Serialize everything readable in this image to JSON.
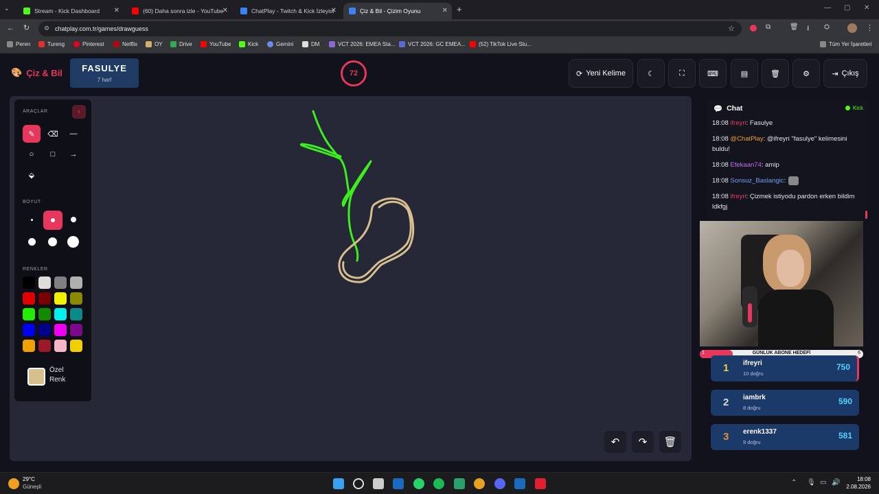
{
  "browser": {
    "tabs": [
      {
        "title": "Stream - Kick Dashboard",
        "color": "#53fc18"
      },
      {
        "title": "(60) Daha sonra izle - YouTube",
        "color": "#ff0000"
      },
      {
        "title": "ChatPlay - Twitch & Kick İzleyici",
        "color": "#3b82f6"
      },
      {
        "title": "Çiz & Bil - Çizim Oyunu",
        "color": "#3b82f6"
      }
    ],
    "url": "chatplay.com.tr/games/drawguess",
    "bookmarks": [
      "Peren",
      "Tureng",
      "Pinterest",
      "Netflix",
      "OY",
      "Drive",
      "YouTube",
      "Kick",
      "Gemini",
      "DM",
      "VCT 2026: EMEA Sta...",
      "VCT 2026: GC EMEA...",
      "(52) TikTok Live Stu..."
    ],
    "all_bookmarks": "Tüm Yer İşaretleri"
  },
  "app": {
    "logo": "Çiz & Bil",
    "word": "FASULYE",
    "word_hint": "7 harf",
    "timer": "72",
    "new_word": "Yeni Kelime",
    "exit": "Çıkış"
  },
  "tools": {
    "section_tools": "ARAÇLAR",
    "section_size": "BOYUT",
    "section_colors": "RENKLER",
    "custom_color_line1": "Özel",
    "custom_color_line2": "Renk",
    "custom_color": "#d8c08e",
    "colors": [
      "#000000",
      "#dddddd",
      "#808080",
      "#b0b0b0",
      "#e00000",
      "#7a0000",
      "#f0f000",
      "#8a8a00",
      "#22ee00",
      "#128a00",
      "#00f0f0",
      "#0b8a8a",
      "#0000f0",
      "#00008a",
      "#f000f0",
      "#7a0a8a",
      "#f0a000",
      "#9a1a2a",
      "#f4b6c6",
      "#f0d000"
    ]
  },
  "chat": {
    "title": "Chat",
    "platform": "Kick",
    "messages": [
      {
        "time": "18:08",
        "user": "ifreyri",
        "color": "#e8375c",
        "text": ": Fasulye"
      },
      {
        "time": "18:08",
        "user": "@ChatPlay",
        "color": "#f0a030",
        "text": ": @ifreyri \"fasulye\" kelimesini buldu!"
      },
      {
        "time": "18:08",
        "user": "Efekaan74",
        "color": "#c070f0",
        "text": ": amip"
      },
      {
        "time": "18:08",
        "user": "Sonsuz_Baslangic",
        "color": "#70a0f0",
        "text": ":"
      },
      {
        "time": "18:08",
        "user": "ifreyri",
        "color": "#e8375c",
        "text": ": Çizmek istiyodu pardon erken bildim ldkfgj"
      }
    ]
  },
  "goal": {
    "label": "GÜNLÜK ABONE HEDEFİ",
    "current": "1",
    "target": "6",
    "progress": 0.2
  },
  "leaderboard": [
    {
      "rank": "1",
      "name": "ifreyri",
      "correct": "10 doğru",
      "points": "750",
      "rank_color": "#f0d040"
    },
    {
      "rank": "2",
      "name": "iambrk",
      "correct": "8 doğru",
      "points": "590",
      "rank_color": "#d8d8e0"
    },
    {
      "rank": "3",
      "name": "erenk1337",
      "correct": "9 doğru",
      "points": "581",
      "rank_color": "#e0903a"
    }
  ],
  "taskbar": {
    "temp": "29°C",
    "weather": "Güneşli",
    "time": "18:08",
    "date": "2.08.2026"
  }
}
